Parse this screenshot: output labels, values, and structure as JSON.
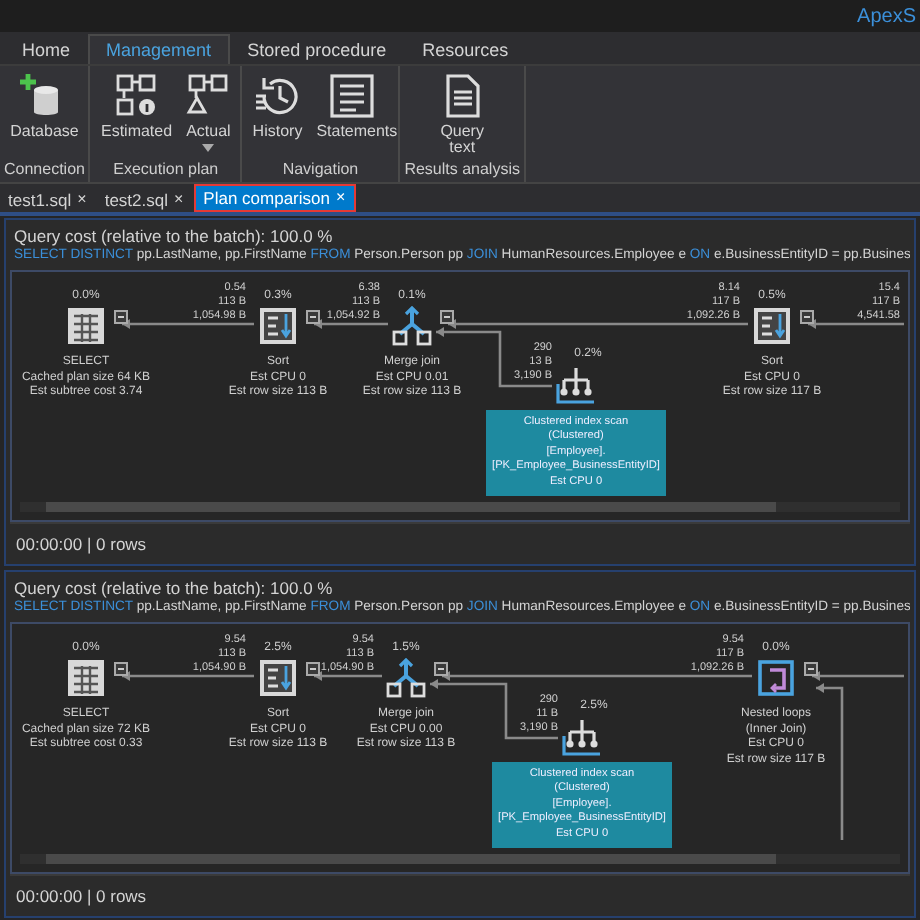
{
  "app": {
    "title": "ApexS"
  },
  "ribbon_tabs": [
    {
      "label": "Home",
      "selected": false
    },
    {
      "label": "Management",
      "selected": true
    },
    {
      "label": "Stored procedure",
      "selected": false
    },
    {
      "label": "Resources",
      "selected": false
    }
  ],
  "ribbon_groups": [
    {
      "label": "Connection",
      "buttons": [
        {
          "kind": "database",
          "label": "Database"
        }
      ]
    },
    {
      "label": "Execution plan",
      "buttons": [
        {
          "kind": "estimated",
          "label": "Estimated"
        },
        {
          "kind": "actual",
          "label": "Actual",
          "dropdown": true
        }
      ]
    },
    {
      "label": "Navigation",
      "buttons": [
        {
          "kind": "history",
          "label": "History"
        },
        {
          "kind": "statements",
          "label": "Statements"
        }
      ]
    },
    {
      "label": "Results analysis",
      "buttons": [
        {
          "kind": "query_text",
          "label": "Query text"
        }
      ]
    }
  ],
  "document_tabs": [
    {
      "label": "test1.sql",
      "close": "×",
      "selected": false
    },
    {
      "label": "test2.sql",
      "close": "×",
      "selected": false
    },
    {
      "label": "Plan comparison",
      "close": "×",
      "selected": true
    }
  ],
  "plans": [
    {
      "cost_header": "Query cost (relative to the batch):  100.0 %",
      "sql": [
        {
          "kind": "keyword",
          "text": "SELECT DISTINCT"
        },
        {
          "kind": "plain",
          "text": " pp.LastName, pp.FirstName "
        },
        {
          "kind": "keyword",
          "text": "FROM"
        },
        {
          "kind": "plain",
          "text": " Person.Person pp "
        },
        {
          "kind": "keyword",
          "text": "JOIN"
        },
        {
          "kind": "plain",
          "text": " HumanResources.Employee e "
        },
        {
          "kind": "keyword",
          "text": "ON"
        },
        {
          "kind": "plain",
          "text": " e.BusinessEntityID = pp.Busines"
        }
      ],
      "nodes": [
        {
          "kind": "select",
          "cost": "0.0%",
          "lines": [
            "SELECT",
            "Cached plan size 64 KB",
            "Est subtree cost 3.74"
          ]
        },
        {
          "kind": "sort",
          "cost": "0.3%",
          "lines": [
            "Sort",
            "Est CPU 0",
            "Est row size 113 B"
          ]
        },
        {
          "kind": "merge",
          "cost": "0.1%",
          "lines": [
            "Merge join",
            "Est CPU 0.01",
            "Est row size 113 B"
          ]
        },
        {
          "kind": "sort",
          "cost": "0.5%",
          "lines": [
            "Sort",
            "Est CPU 0",
            "Est row size 117 B"
          ]
        }
      ],
      "edges": [
        [
          "0.54",
          "113 B",
          "1,054.98 B"
        ],
        [
          "6.38",
          "113 B",
          "1,054.92 B"
        ],
        [
          "8.14",
          "117 B",
          "1,092.26 B"
        ]
      ],
      "trailing_edge": [
        "15.4",
        "117 B",
        "4,541.58"
      ],
      "branch": {
        "kind": "scan",
        "cost": "0.2%",
        "edge": [
          "290",
          "13 B",
          "3,190 B"
        ],
        "highlighted": true,
        "lines": [
          "Clustered index scan",
          "(Clustered)",
          "[Employee].",
          "[PK_Employee_BusinessEntityID]",
          "Est CPU 0"
        ]
      },
      "status": "00:00:00 | 0 rows"
    },
    {
      "cost_header": "Query cost (relative to the batch):  100.0 %",
      "sql": [
        {
          "kind": "keyword",
          "text": "SELECT DISTINCT"
        },
        {
          "kind": "plain",
          "text": " pp.LastName, pp.FirstName "
        },
        {
          "kind": "keyword",
          "text": "FROM"
        },
        {
          "kind": "plain",
          "text": " Person.Person pp "
        },
        {
          "kind": "keyword",
          "text": "JOIN"
        },
        {
          "kind": "plain",
          "text": " HumanResources.Employee e "
        },
        {
          "kind": "keyword",
          "text": "ON"
        },
        {
          "kind": "plain",
          "text": " e.BusinessEntityID = pp.Busines"
        }
      ],
      "nodes": [
        {
          "kind": "select",
          "cost": "0.0%",
          "lines": [
            "SELECT",
            "Cached plan size 72 KB",
            "Est subtree cost 0.33"
          ]
        },
        {
          "kind": "sort",
          "cost": "2.5%",
          "lines": [
            "Sort",
            "Est CPU 0",
            "Est row size 113 B"
          ]
        },
        {
          "kind": "merge",
          "cost": "1.5%",
          "lines": [
            "Merge join",
            "Est CPU 0.00",
            "Est row size 113 B"
          ]
        },
        {
          "kind": "loops",
          "cost": "0.0%",
          "lines": [
            "Nested loops",
            "(Inner Join)",
            "Est CPU 0",
            "Est row size 117 B"
          ]
        }
      ],
      "edges": [
        [
          "9.54",
          "113 B",
          "1,054.90 B"
        ],
        [
          "9.54",
          "113 B",
          "1,054.90 B"
        ],
        [
          "9.54",
          "117 B",
          "1,092.26 B"
        ]
      ],
      "branch": {
        "kind": "scan",
        "cost": "2.5%",
        "edge": [
          "290",
          "11 B",
          "3,190 B"
        ],
        "highlighted": true,
        "lines": [
          "Clustered index scan",
          "(Clustered)",
          "[Employee].",
          "[PK_Employee_BusinessEntityID]",
          "Est CPU 0"
        ]
      },
      "status": "00:00:00 | 0 rows"
    }
  ]
}
